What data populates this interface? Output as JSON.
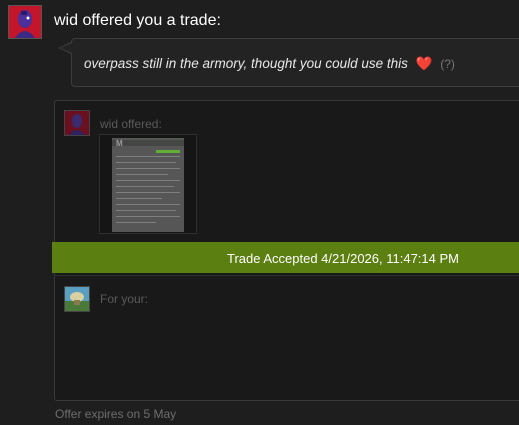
{
  "trade": {
    "headline": "wid offered you a trade:",
    "message": "overpass still in the armory, thought you could use this",
    "message_emoji": "❤️",
    "help_label": "(?)",
    "offered_label": "wid offered:",
    "item_logo_text": "M",
    "status": "Trade Accepted 4/21/2026, 11:47:14 PM",
    "for_your_label": "For your:",
    "expires": "Offer expires on 5 May"
  },
  "colors": {
    "status_bar": "#5c7f12",
    "avatar_wid": "#c3152b",
    "heart": "#e0313f"
  },
  "icons": {
    "avatar_main": "wid-avatar",
    "avatar_small": "wid-avatar",
    "avatar_your": "user-avatar",
    "item": "document-item"
  }
}
